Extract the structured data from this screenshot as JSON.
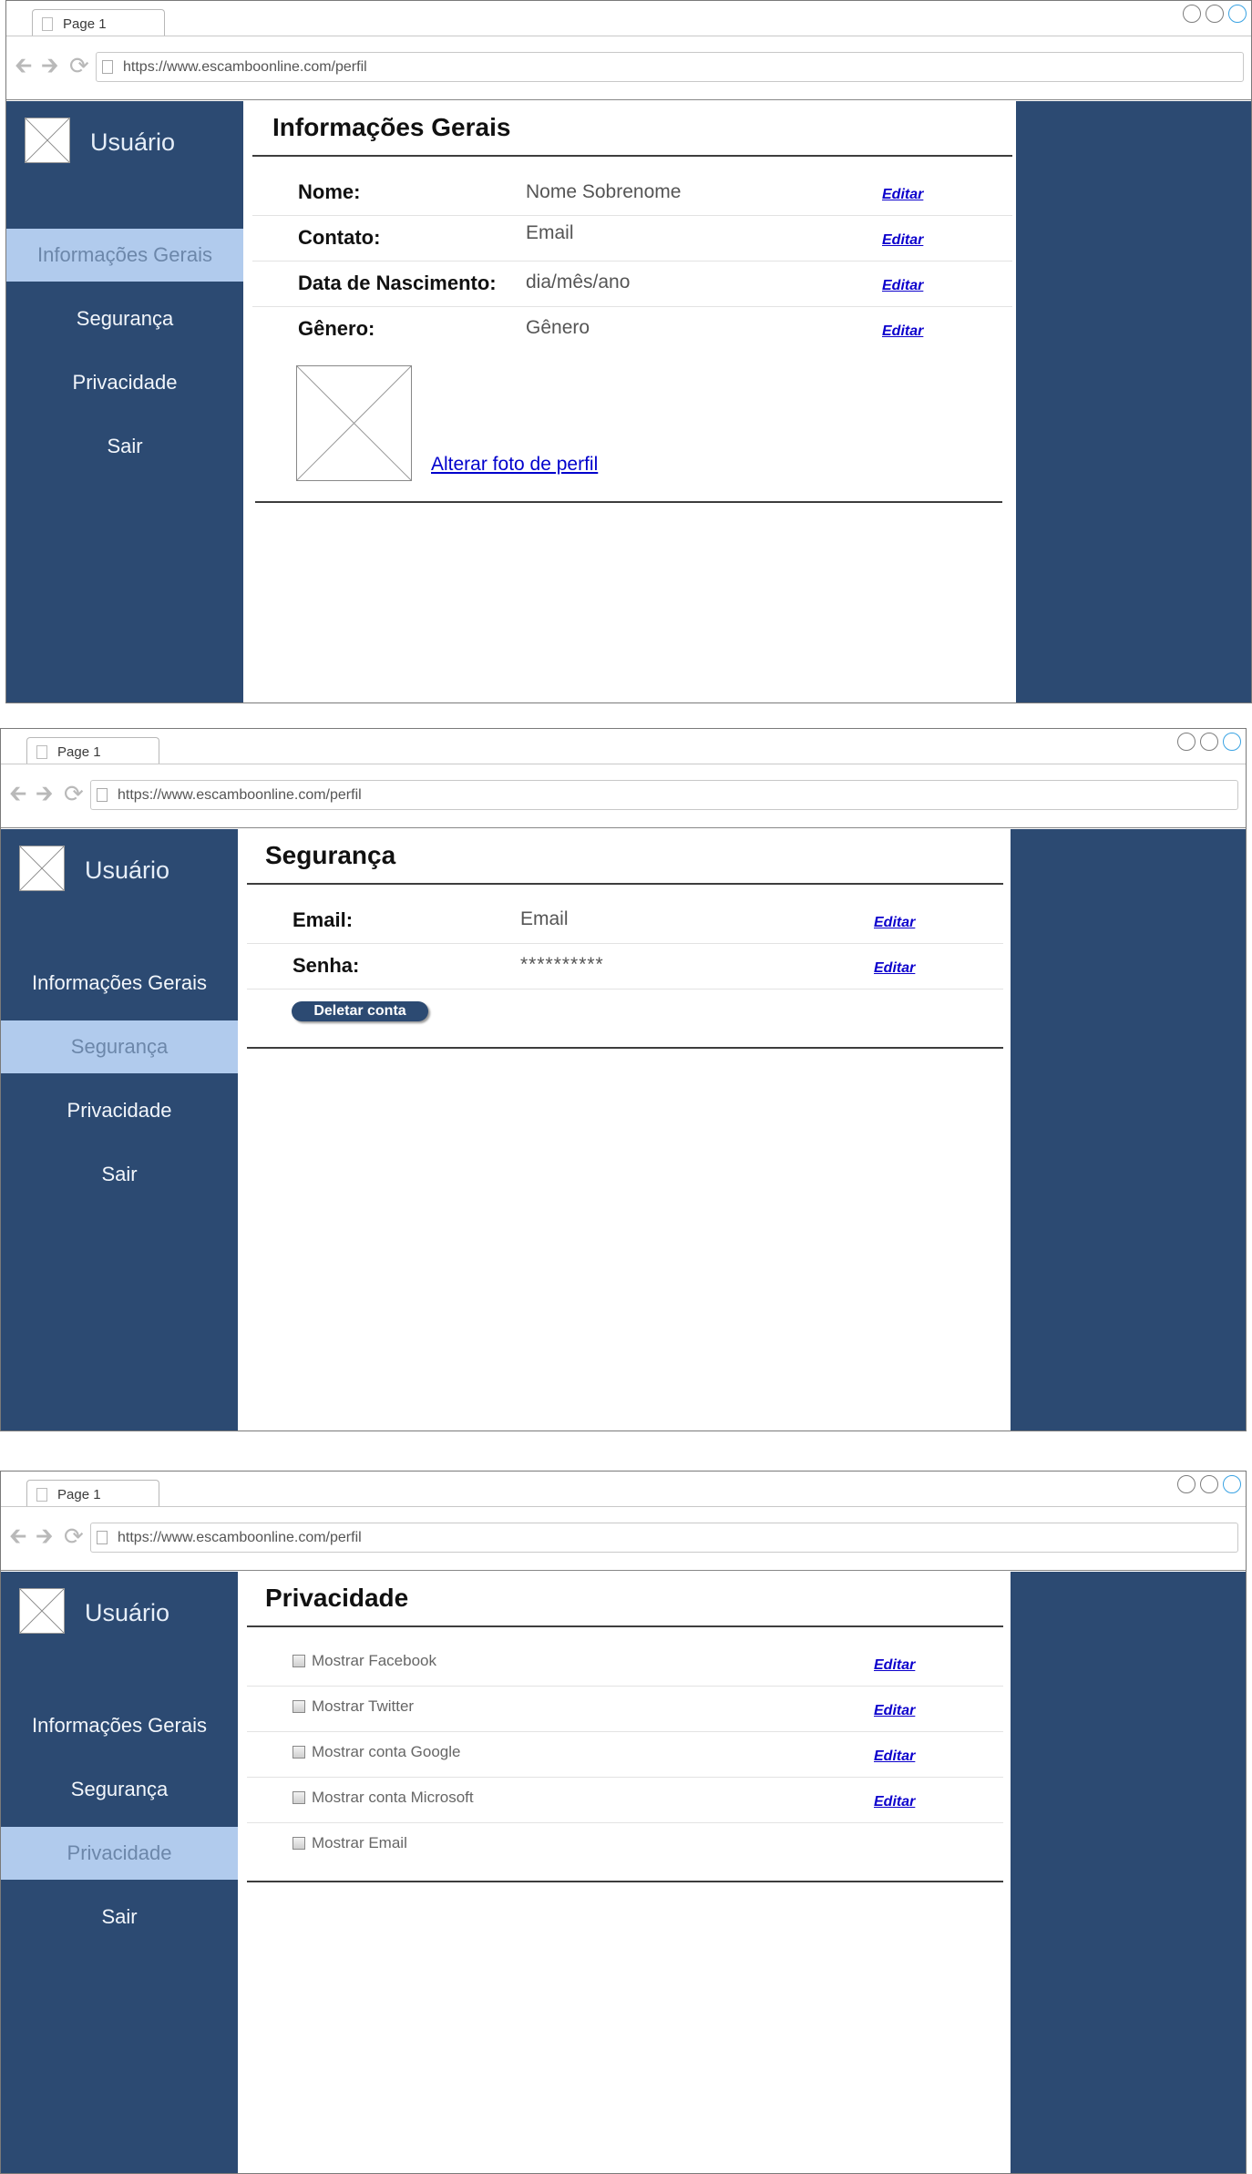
{
  "browser": {
    "tab_title": "Page 1",
    "url": "https://www.escamboonline.com/perfil"
  },
  "sidebar": {
    "username": "Usuário",
    "items": [
      {
        "label": "Informações Gerais"
      },
      {
        "label": "Segurança"
      },
      {
        "label": "Privacidade"
      },
      {
        "label": "Sair"
      }
    ]
  },
  "screens": [
    {
      "active_nav": "Informações Gerais",
      "title": "Informações Gerais",
      "fields": [
        {
          "label": "Nome:",
          "value": "Nome Sobrenome",
          "action": "Editar"
        },
        {
          "label": "Contato:",
          "value": "Email",
          "action": "Editar"
        },
        {
          "label": "Data de Nascimento:",
          "value": "dia/mês/ano",
          "action": "Editar"
        },
        {
          "label": "Gênero:",
          "value": "Gênero",
          "action": "Editar"
        }
      ],
      "photo_link": "Alterar foto de perfil"
    },
    {
      "active_nav": "Segurança",
      "title": "Segurança",
      "fields": [
        {
          "label": "Email:",
          "value": "Email",
          "action": "Editar"
        },
        {
          "label": "Senha:",
          "value": "**********",
          "action": "Editar"
        }
      ],
      "delete_button": "Deletar conta"
    },
    {
      "active_nav": "Privacidade",
      "title": "Privacidade",
      "options": [
        {
          "label": "Mostrar Facebook",
          "checked": false,
          "action": "Editar"
        },
        {
          "label": "Mostrar Twitter",
          "checked": false,
          "action": "Editar"
        },
        {
          "label": "Mostrar conta Google",
          "checked": false,
          "action": "Editar"
        },
        {
          "label": "Mostrar conta Microsoft",
          "checked": false,
          "action": "Editar"
        },
        {
          "label": "Mostrar Email",
          "checked": false,
          "action": ""
        }
      ]
    }
  ],
  "colors": {
    "sidebar_bg": "#2c4a72",
    "active_nav_bg": "#b1cbed",
    "link_blue": "#0c00cc"
  }
}
